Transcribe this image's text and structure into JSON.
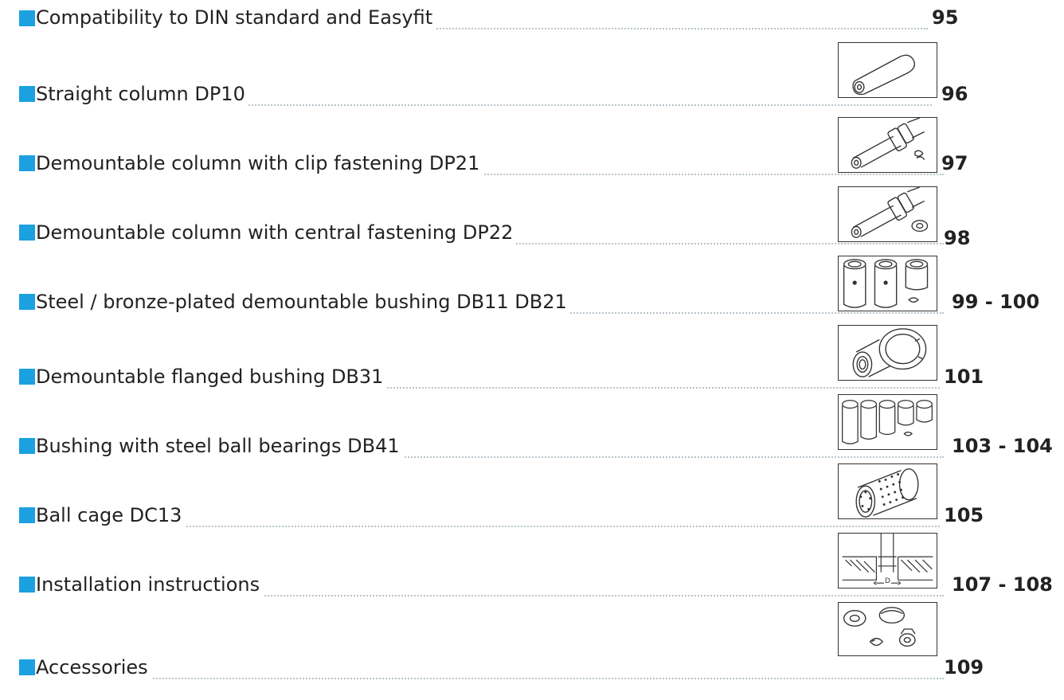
{
  "toc": {
    "entries": [
      {
        "title": "Compatibility to DIN standard and Easyfit",
        "page": "95",
        "icon": null
      },
      {
        "title": "Straight column DP10",
        "page": "96",
        "icon": "straight-column-icon"
      },
      {
        "title": "Demountable column with clip fastening DP21",
        "page": "97",
        "icon": "clip-column-icon"
      },
      {
        "title": "Demountable column with central fastening DP22",
        "page": "98",
        "icon": "central-column-icon"
      },
      {
        "title": "Steel / bronze-plated demountable bushing DB11 DB21",
        "page": "99 - 100",
        "icon": "bushings-icon"
      },
      {
        "title": "Demountable flanged bushing DB31",
        "page": "101",
        "icon": "flanged-bushing-icon"
      },
      {
        "title": "Bushing with steel ball bearings DB41",
        "page": "103 - 104",
        "icon": "ball-bushings-icon"
      },
      {
        "title": "Ball cage DC13",
        "page": "105",
        "icon": "ball-cage-icon"
      },
      {
        "title": "Installation instructions",
        "page": "107 - 108",
        "icon": "installation-diagram-icon"
      },
      {
        "title": "Accessories",
        "page": "109",
        "icon": "accessories-icon"
      }
    ],
    "thumb_label_d": "D",
    "bullet_color": "#1ba0e0"
  }
}
